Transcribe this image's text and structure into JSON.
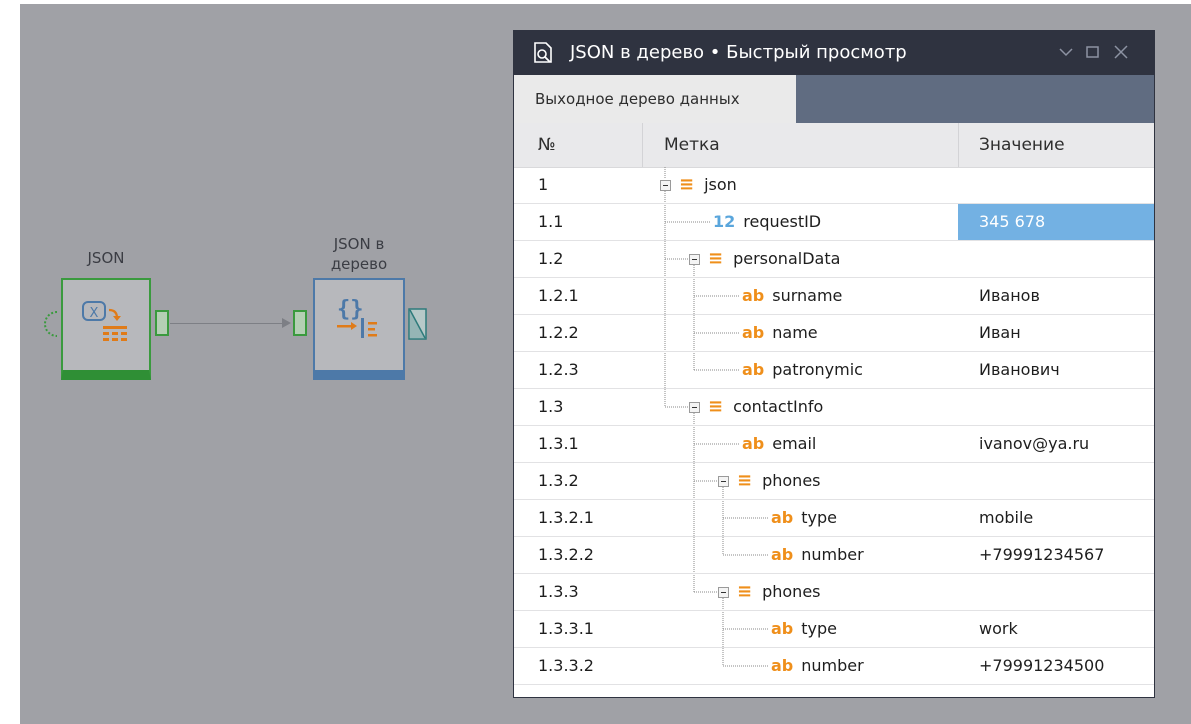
{
  "canvas": {
    "nodes": [
      {
        "label": "JSON"
      },
      {
        "label": "JSON в\nдерево"
      }
    ]
  },
  "window": {
    "title": "JSON в дерево • Быстрый просмотр",
    "tab_label": "Выходное дерево данных",
    "columns": {
      "num": "№",
      "label": "Метка",
      "value": "Значение"
    },
    "rows": [
      {
        "num": "1",
        "label": "json",
        "type": "object",
        "value": ""
      },
      {
        "num": "1.1",
        "label": "requestID",
        "type": "number",
        "value": "345 678",
        "selected": true
      },
      {
        "num": "1.2",
        "label": "personalData",
        "type": "object",
        "value": ""
      },
      {
        "num": "1.2.1",
        "label": "surname",
        "type": "string",
        "value": "Иванов"
      },
      {
        "num": "1.2.2",
        "label": "name",
        "type": "string",
        "value": "Иван"
      },
      {
        "num": "1.2.3",
        "label": "patronymic",
        "type": "string",
        "value": "Иванович"
      },
      {
        "num": "1.3",
        "label": "contactInfo",
        "type": "object",
        "value": ""
      },
      {
        "num": "1.3.1",
        "label": "email",
        "type": "string",
        "value": "ivanov@ya.ru"
      },
      {
        "num": "1.3.2",
        "label": "phones",
        "type": "object",
        "value": ""
      },
      {
        "num": "1.3.2.1",
        "label": "type",
        "type": "string",
        "value": "mobile"
      },
      {
        "num": "1.3.2.2",
        "label": "number",
        "type": "string",
        "value": "+79991234567"
      },
      {
        "num": "1.3.3",
        "label": "phones",
        "type": "object",
        "value": ""
      },
      {
        "num": "1.3.3.1",
        "label": "type",
        "type": "string",
        "value": "work"
      },
      {
        "num": "1.3.3.2",
        "label": "number",
        "type": "string",
        "value": "+79991234500"
      }
    ],
    "type_glyphs": {
      "number": "12",
      "string": "ab",
      "object": "≡"
    },
    "colors": {
      "selection": "#73b1e3",
      "string_icon": "#ef8f1b",
      "number_icon": "#5aa6dc",
      "titlebar": "#2f3340"
    }
  }
}
